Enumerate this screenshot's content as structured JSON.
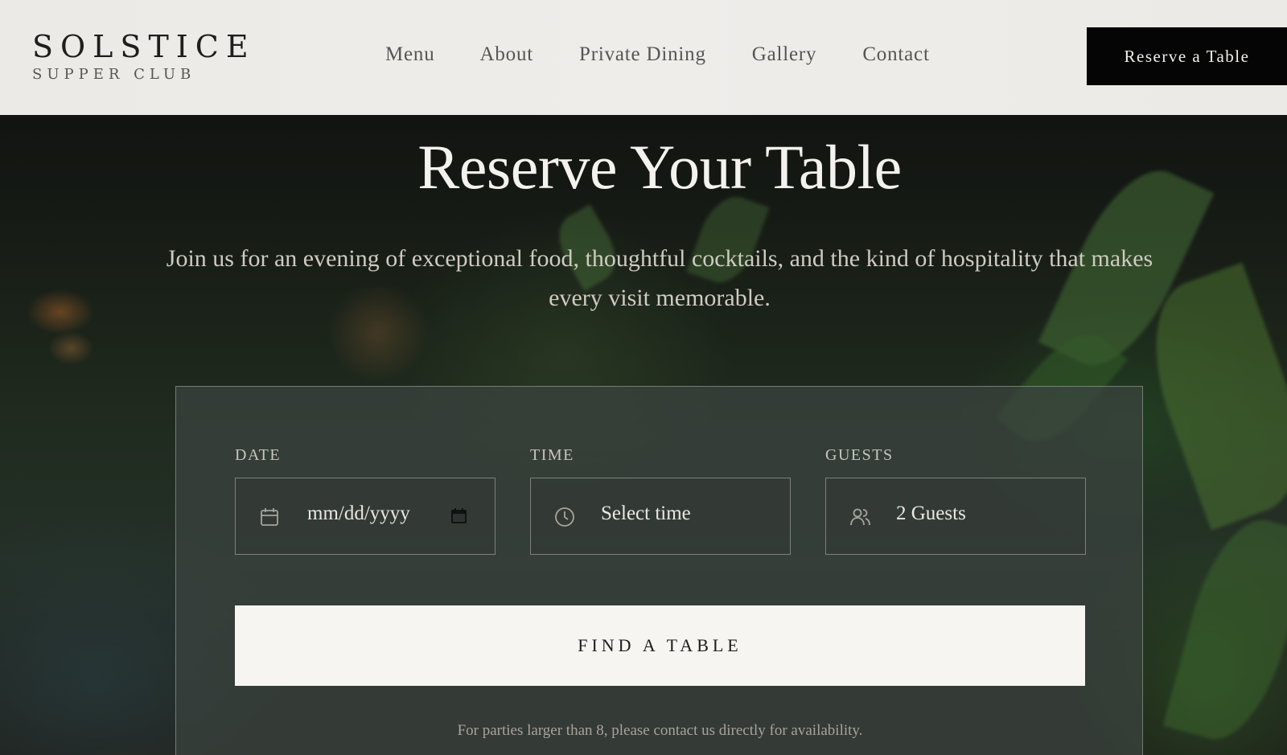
{
  "brand": {
    "name": "SOLSTICE",
    "tagline": "SUPPER CLUB"
  },
  "nav": {
    "items": [
      {
        "label": "Menu"
      },
      {
        "label": "About"
      },
      {
        "label": "Private Dining"
      },
      {
        "label": "Gallery"
      },
      {
        "label": "Contact"
      }
    ],
    "cta_label": "Reserve a Table"
  },
  "hero": {
    "title": "Reserve Your Table",
    "subtitle": "Join us for an evening of exceptional food, thoughtful cocktails, and the kind of hospitality that makes every visit memorable."
  },
  "booking": {
    "date": {
      "label": "DATE",
      "placeholder": "mm/dd/yyyy",
      "icon": "calendar-icon"
    },
    "time": {
      "label": "TIME",
      "value": "Select time",
      "icon": "clock-icon"
    },
    "guests": {
      "label": "GUESTS",
      "value": "2 Guests",
      "icon": "users-icon"
    },
    "submit_label": "FIND A TABLE",
    "note": "For parties larger than 8, please contact us directly for availability."
  },
  "colors": {
    "header_bg": "#eceae6",
    "cta_bg": "#050505",
    "button_light": "#f6f5f2"
  }
}
